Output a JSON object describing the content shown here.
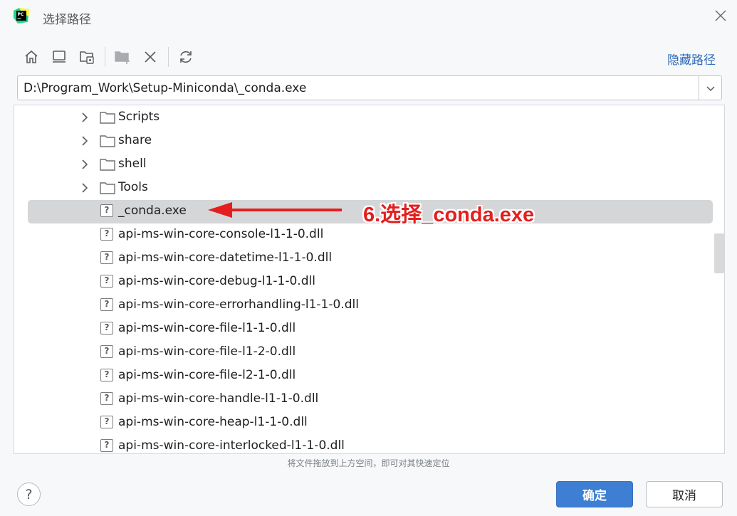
{
  "window": {
    "title": "选择路径",
    "app_logo_text": "PC"
  },
  "toolbar": {
    "buttons": [
      "home-icon",
      "desktop-icon",
      "project-folder-icon",
      "new-folder-icon",
      "delete-icon",
      "refresh-icon"
    ],
    "hide_path_label": "隐藏路径"
  },
  "path": {
    "value": "D:\\Program_Work\\Setup-Miniconda\\_conda.exe"
  },
  "tree": {
    "rows": [
      {
        "label": "Scripts",
        "type": "folder"
      },
      {
        "label": "share",
        "type": "folder"
      },
      {
        "label": "shell",
        "type": "folder"
      },
      {
        "label": "Tools",
        "type": "folder"
      },
      {
        "label": "_conda.exe",
        "type": "file",
        "selected": true
      },
      {
        "label": "api-ms-win-core-console-l1-1-0.dll",
        "type": "file"
      },
      {
        "label": "api-ms-win-core-datetime-l1-1-0.dll",
        "type": "file"
      },
      {
        "label": "api-ms-win-core-debug-l1-1-0.dll",
        "type": "file"
      },
      {
        "label": "api-ms-win-core-errorhandling-l1-1-0.dll",
        "type": "file"
      },
      {
        "label": "api-ms-win-core-file-l1-1-0.dll",
        "type": "file"
      },
      {
        "label": "api-ms-win-core-file-l1-2-0.dll",
        "type": "file"
      },
      {
        "label": "api-ms-win-core-file-l2-1-0.dll",
        "type": "file"
      },
      {
        "label": "api-ms-win-core-handle-l1-1-0.dll",
        "type": "file"
      },
      {
        "label": "api-ms-win-core-heap-l1-1-0.dll",
        "type": "file"
      },
      {
        "label": "api-ms-win-core-interlocked-l1-1-0.dll",
        "type": "file"
      }
    ]
  },
  "annotation": {
    "text": "6.选择_conda.exe",
    "color": "#e41e1e"
  },
  "hint": "将文件拖放到上方空间，即可对其快速定位",
  "footer": {
    "help_label": "?",
    "ok_label": "确定",
    "cancel_label": "取消"
  },
  "colors": {
    "accent": "#3e7fd3",
    "link": "#2e6bb8",
    "selection": "#d5d6d8"
  }
}
